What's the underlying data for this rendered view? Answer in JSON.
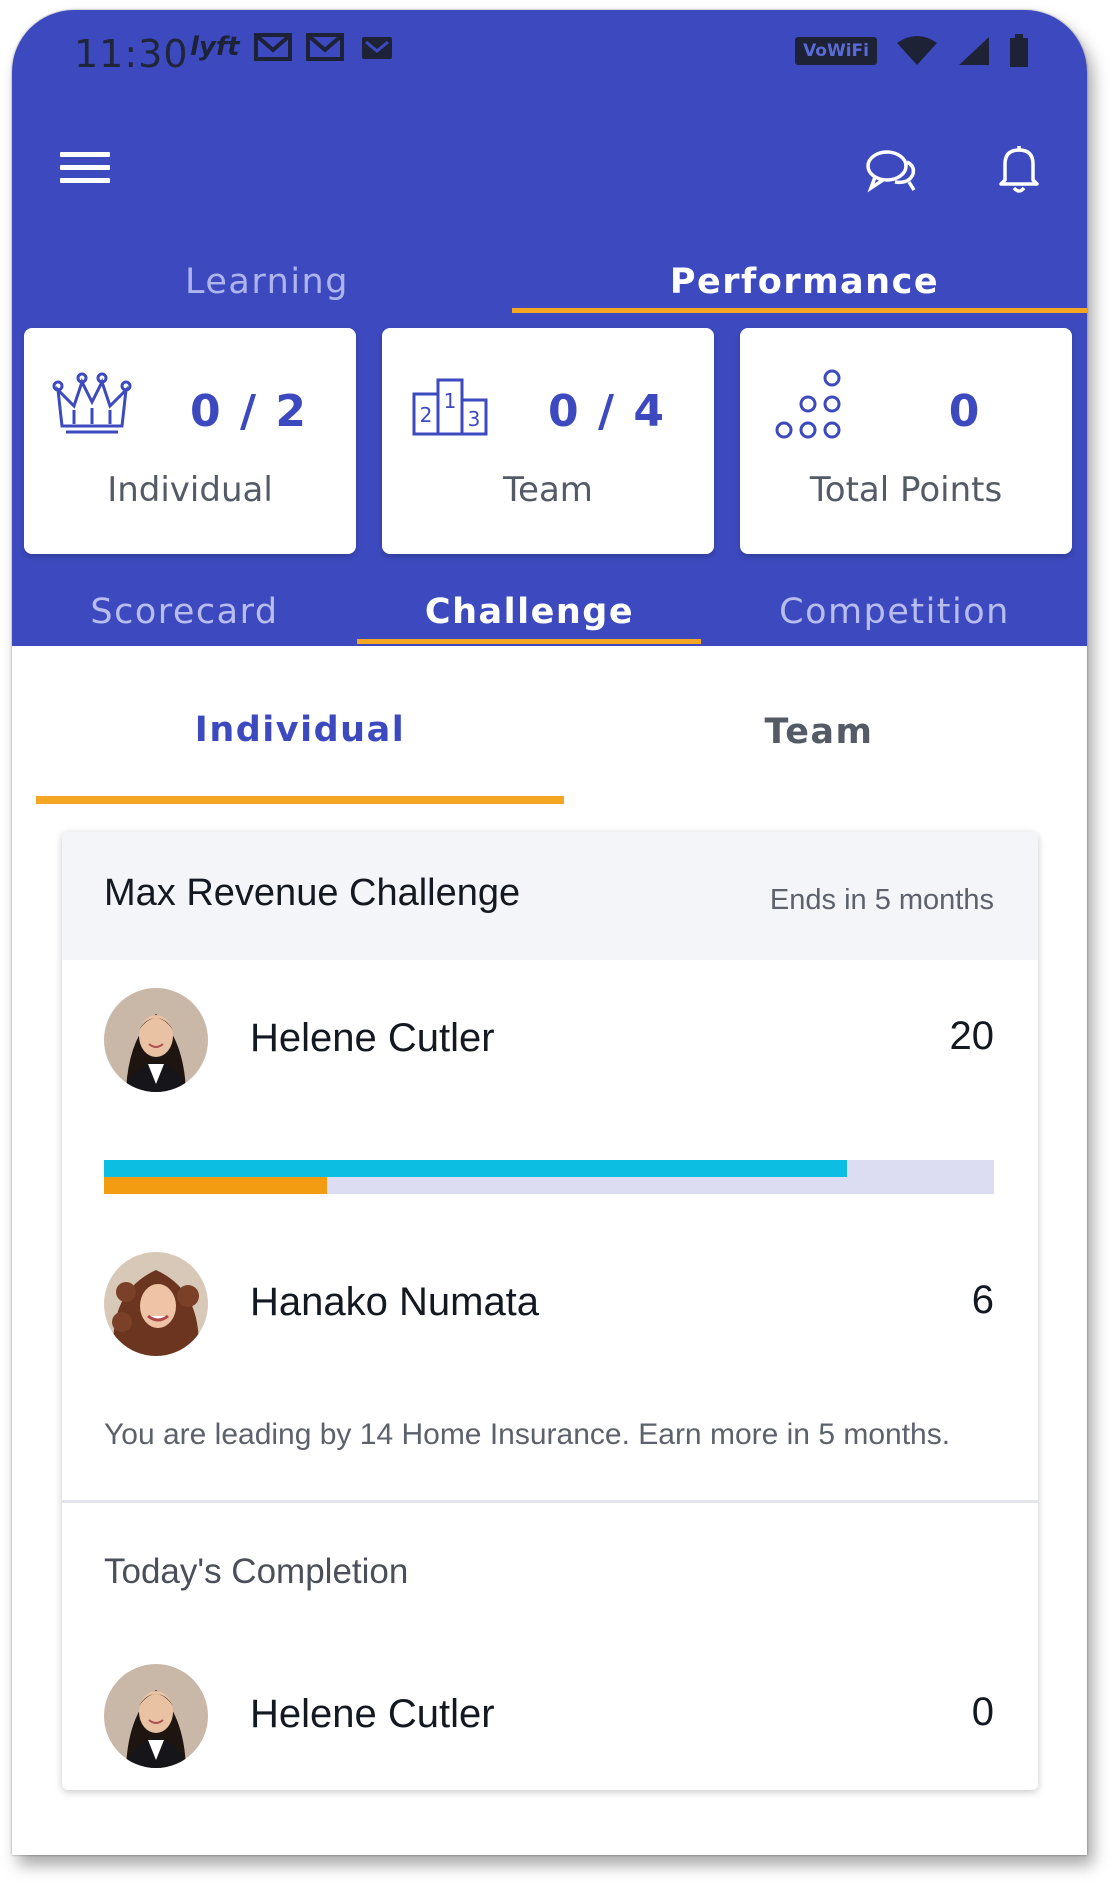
{
  "status_bar": {
    "time": "11:30",
    "app_icons": [
      "lyft-icon",
      "mail-icon",
      "mail-icon",
      "gmail-icon"
    ],
    "vowifi": "VoWiFi"
  },
  "top_tabs": [
    {
      "label": "Learning",
      "active": false
    },
    {
      "label": "Performance",
      "active": true
    }
  ],
  "stats": [
    {
      "icon": "crown-icon",
      "value": "0 / 2",
      "label": "Individual"
    },
    {
      "icon": "podium-icon",
      "value": "0 / 4",
      "label": "Team"
    },
    {
      "icon": "points-icon",
      "value": "0",
      "label": "Total Points"
    }
  ],
  "mid_tabs": [
    {
      "label": "Scorecard",
      "active": false
    },
    {
      "label": "Challenge",
      "active": true
    },
    {
      "label": "Competition",
      "active": false
    }
  ],
  "sub_tabs": [
    {
      "label": "Individual",
      "active": true
    },
    {
      "label": "Team",
      "active": false
    }
  ],
  "challenge": {
    "title": "Max Revenue Challenge",
    "ends": "Ends in 5 months",
    "participants": [
      {
        "name": "Helene Cutler",
        "score": "20"
      },
      {
        "name": "Hanako Numata",
        "score": "6"
      }
    ],
    "progress": {
      "leader_fraction": 0.835,
      "second_fraction": 0.25
    },
    "leading_text": "You are leading by 14 Home Insurance. Earn more in 5 months.",
    "completion": {
      "title": "Today's Completion",
      "rows": [
        {
          "name": "Helene Cutler",
          "score": "0"
        }
      ]
    }
  },
  "colors": {
    "primary": "#3d4abf",
    "accent": "#f5a623",
    "progress_leader": "#0cbfe2",
    "progress_second": "#f39c12",
    "progress_track": "#dcdcf2"
  }
}
